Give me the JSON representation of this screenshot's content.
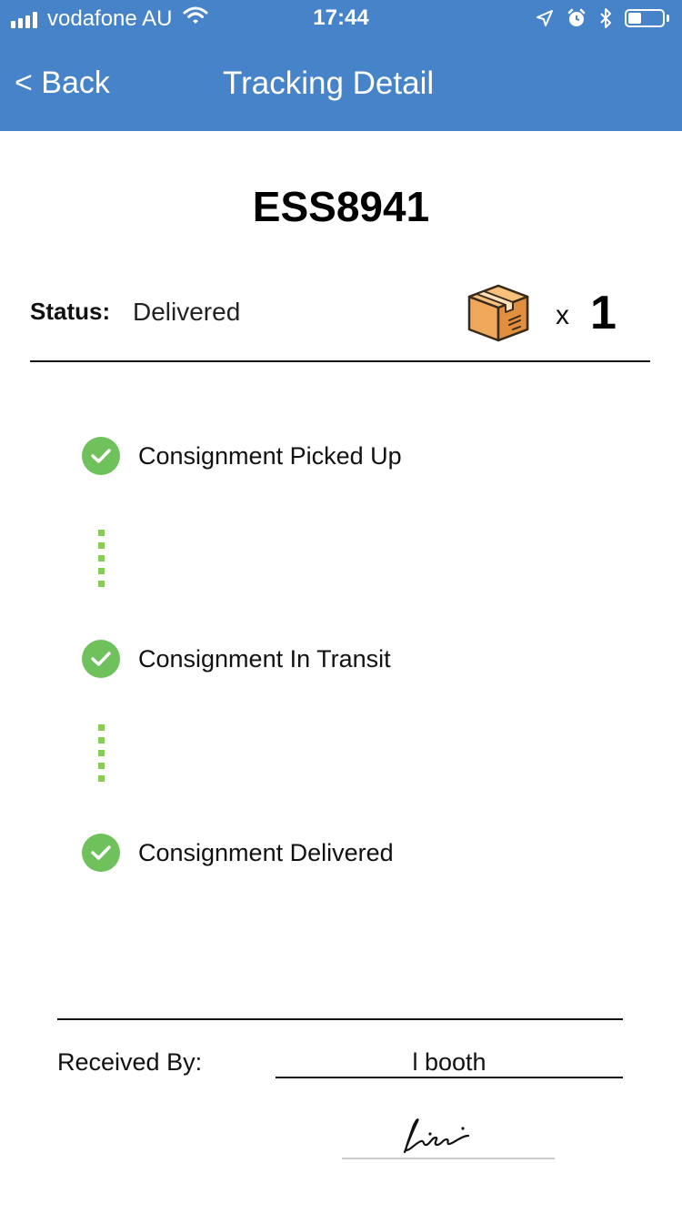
{
  "status_bar": {
    "carrier": "vodafone AU",
    "time": "17:44",
    "signal_icon": "cellular-signal-icon",
    "wifi_icon": "wifi-icon",
    "location_icon": "location-arrow-icon",
    "alarm_icon": "alarm-clock-icon",
    "bluetooth_icon": "bluetooth-icon",
    "battery_icon": "battery-icon",
    "battery_level": 0.4
  },
  "nav": {
    "back_label": "< Back",
    "title": "Tracking Detail",
    "color": "#4783c8"
  },
  "consignment": {
    "id": "ESS8941",
    "status_label": "Status:",
    "status_value": "Delivered",
    "package_icon": "cardboard-box-icon",
    "quantity_prefix": "x",
    "quantity": "1"
  },
  "steps": [
    {
      "label": "Consignment Picked Up",
      "icon": "check-circle-icon"
    },
    {
      "label": "Consignment In Transit",
      "icon": "check-circle-icon"
    },
    {
      "label": "Consignment Delivered",
      "icon": "check-circle-icon"
    }
  ],
  "accent_colors": {
    "check": "#6fc15b",
    "connector": "#86cc57"
  },
  "receipt": {
    "received_by_label": "Received By:",
    "received_by_value": "l booth",
    "signature": "handwritten-signature"
  }
}
